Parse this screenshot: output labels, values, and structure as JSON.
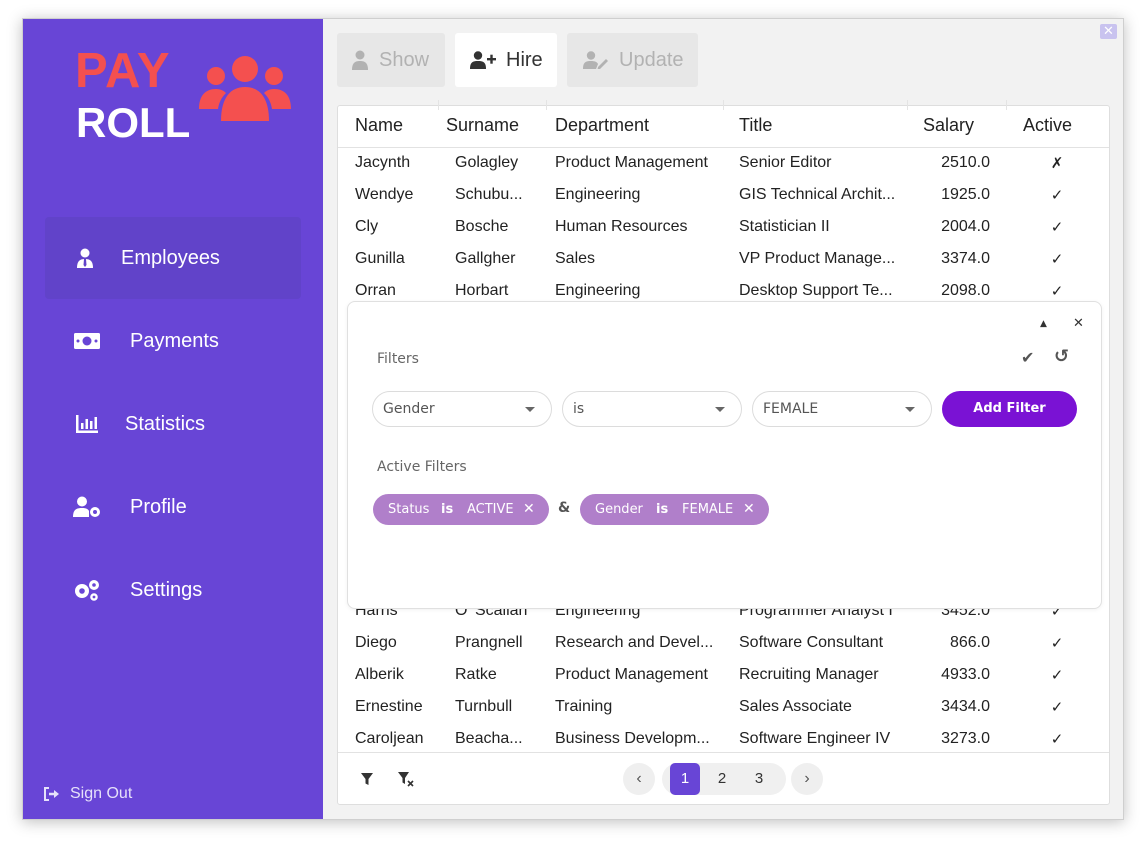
{
  "logo": {
    "line1": "PAY",
    "line2": "ROLL"
  },
  "sidebar": {
    "items": [
      {
        "label": "Employees",
        "icon": "user-tie-icon",
        "active": true
      },
      {
        "label": "Payments",
        "icon": "money-bill-icon"
      },
      {
        "label": "Statistics",
        "icon": "chart-bar-icon"
      },
      {
        "label": "Profile",
        "icon": "user-cog-icon"
      },
      {
        "label": "Settings",
        "icon": "gears-icon"
      }
    ],
    "signout": "Sign Out"
  },
  "tabs": [
    {
      "label": "Show",
      "state": "disabled"
    },
    {
      "label": "Hire",
      "state": "active"
    },
    {
      "label": "Update",
      "state": "disabled"
    }
  ],
  "table": {
    "columns": [
      "Name",
      "Surname",
      "Department",
      "Title",
      "Salary",
      "Active"
    ],
    "rows": [
      {
        "name": "Jacynth",
        "surname": "Golagley",
        "department": "Product Management",
        "title": "Senior Editor",
        "salary": "2510.0",
        "active": "✗"
      },
      {
        "name": "Wendye",
        "surname": "Schubu...",
        "department": "Engineering",
        "title": "GIS Technical Archit...",
        "salary": "1925.0",
        "active": "✓"
      },
      {
        "name": "Cly",
        "surname": "Bosche",
        "department": "Human Resources",
        "title": "Statistician II",
        "salary": "2004.0",
        "active": "✓"
      },
      {
        "name": "Gunilla",
        "surname": "Gallgher",
        "department": "Sales",
        "title": "VP Product Manage...",
        "salary": "3374.0",
        "active": "✓"
      },
      {
        "name": "Orran",
        "surname": "Horbart",
        "department": "Engineering",
        "title": "Desktop Support Te...",
        "salary": "2098.0",
        "active": "✓"
      },
      {
        "name": "Harris",
        "surname": "O' Scallan",
        "department": "Engineering",
        "title": "Programmer Analyst I",
        "salary": "3452.0",
        "active": "✓"
      },
      {
        "name": "Diego",
        "surname": "Prangnell",
        "department": "Research and Devel...",
        "title": "Software Consultant",
        "salary": "866.0",
        "active": "✓"
      },
      {
        "name": "Alberik",
        "surname": "Ratke",
        "department": "Product Management",
        "title": "Recruiting Manager",
        "salary": "4933.0",
        "active": "✓"
      },
      {
        "name": "Ernestine",
        "surname": "Turnbull",
        "department": "Training",
        "title": "Sales Associate",
        "salary": "3434.0",
        "active": "✓"
      },
      {
        "name": "Caroljean",
        "surname": "Beacha...",
        "department": "Business Developm...",
        "title": "Software Engineer IV",
        "salary": "3273.0",
        "active": "✓"
      }
    ]
  },
  "pagination": {
    "pages": [
      "1",
      "2",
      "3"
    ],
    "current": "1",
    "prev": "‹",
    "next": "›"
  },
  "filters": {
    "title": "Filters",
    "field": "Gender",
    "operator": "is",
    "value": "FEMALE",
    "add_label": "Add Filter",
    "active_title": "Active Filters",
    "joiner": "&",
    "active": [
      {
        "field": "Status",
        "op": "is",
        "value": "ACTIVE"
      },
      {
        "field": "Gender",
        "op": "is",
        "value": "FEMALE"
      }
    ],
    "controls": {
      "collapse": "▲",
      "close": "✕",
      "apply": "✔",
      "reset": "↺",
      "chip_remove": "✕"
    }
  },
  "colors": {
    "sidebar": "#6845d6",
    "accent": "#7a12d4",
    "logo_red": "#f4504f",
    "chip": "#b07fca"
  }
}
